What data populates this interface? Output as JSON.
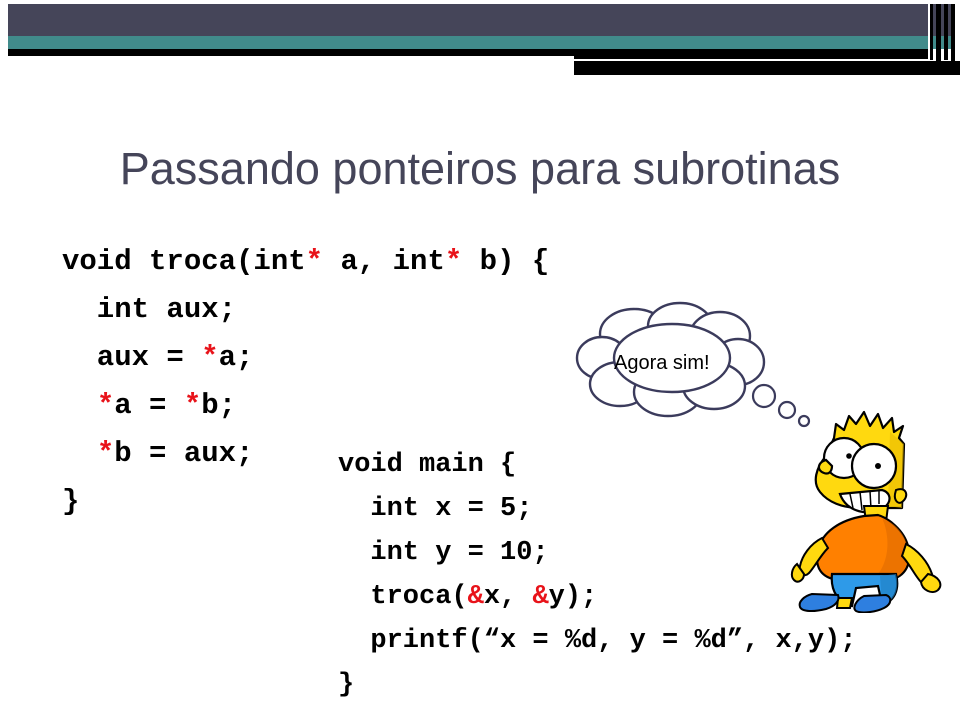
{
  "slide": {
    "title": "Passando ponteiros para subrotinas",
    "title_color": "#454559",
    "background_color": "#ffffff"
  },
  "header": {
    "slate_color": "#454559",
    "teal_color": "#418b8b",
    "black_color": "#000000"
  },
  "code_troca": {
    "lines": [
      [
        {
          "t": "void troca(int",
          "c": "black"
        },
        {
          "t": "*",
          "c": "red"
        },
        {
          "t": " a, int",
          "c": "black"
        },
        {
          "t": "*",
          "c": "red"
        },
        {
          "t": " b) {",
          "c": "black"
        }
      ],
      [
        {
          "t": "  int aux;",
          "c": "black"
        }
      ],
      [
        {
          "t": "  aux = ",
          "c": "black"
        },
        {
          "t": "*",
          "c": "red"
        },
        {
          "t": "a;",
          "c": "black"
        }
      ],
      [
        {
          "t": "  ",
          "c": "black"
        },
        {
          "t": "*",
          "c": "red"
        },
        {
          "t": "a = ",
          "c": "black"
        },
        {
          "t": "*",
          "c": "red"
        },
        {
          "t": "b;",
          "c": "black"
        }
      ],
      [
        {
          "t": "  ",
          "c": "black"
        },
        {
          "t": "*",
          "c": "red"
        },
        {
          "t": "b = aux;",
          "c": "black"
        }
      ],
      [
        {
          "t": "}",
          "c": "black"
        }
      ]
    ]
  },
  "code_main": {
    "lines": [
      [
        {
          "t": "void main {",
          "c": "black"
        }
      ],
      [
        {
          "t": "  int x = 5;",
          "c": "black"
        }
      ],
      [
        {
          "t": "  int y = 10;",
          "c": "black"
        }
      ],
      [
        {
          "t": "  troca(",
          "c": "black"
        },
        {
          "t": "&",
          "c": "red"
        },
        {
          "t": "x, ",
          "c": "black"
        },
        {
          "t": "&",
          "c": "red"
        },
        {
          "t": "y);",
          "c": "black"
        }
      ],
      [
        {
          "t": "  printf(“x = %d, y = %d”, x,y);",
          "c": "black"
        }
      ],
      [
        {
          "t": "}",
          "c": "black"
        }
      ]
    ]
  },
  "thought_bubble": {
    "text": "Agora sim!",
    "outline_color": "#3b3b5c",
    "fill_color": "#ffffff"
  },
  "character": {
    "name": "bart-simpson",
    "skin_color": "#ffd90f",
    "skin_shadow": "#e8b800",
    "shirt_color": "#ff8000",
    "shirt_shadow": "#e06a00",
    "shorts_color": "#2e9ae8",
    "shorts_shadow": "#1f7fc4",
    "shoe_color": "#2e7fe0",
    "outline_color": "#000000"
  }
}
